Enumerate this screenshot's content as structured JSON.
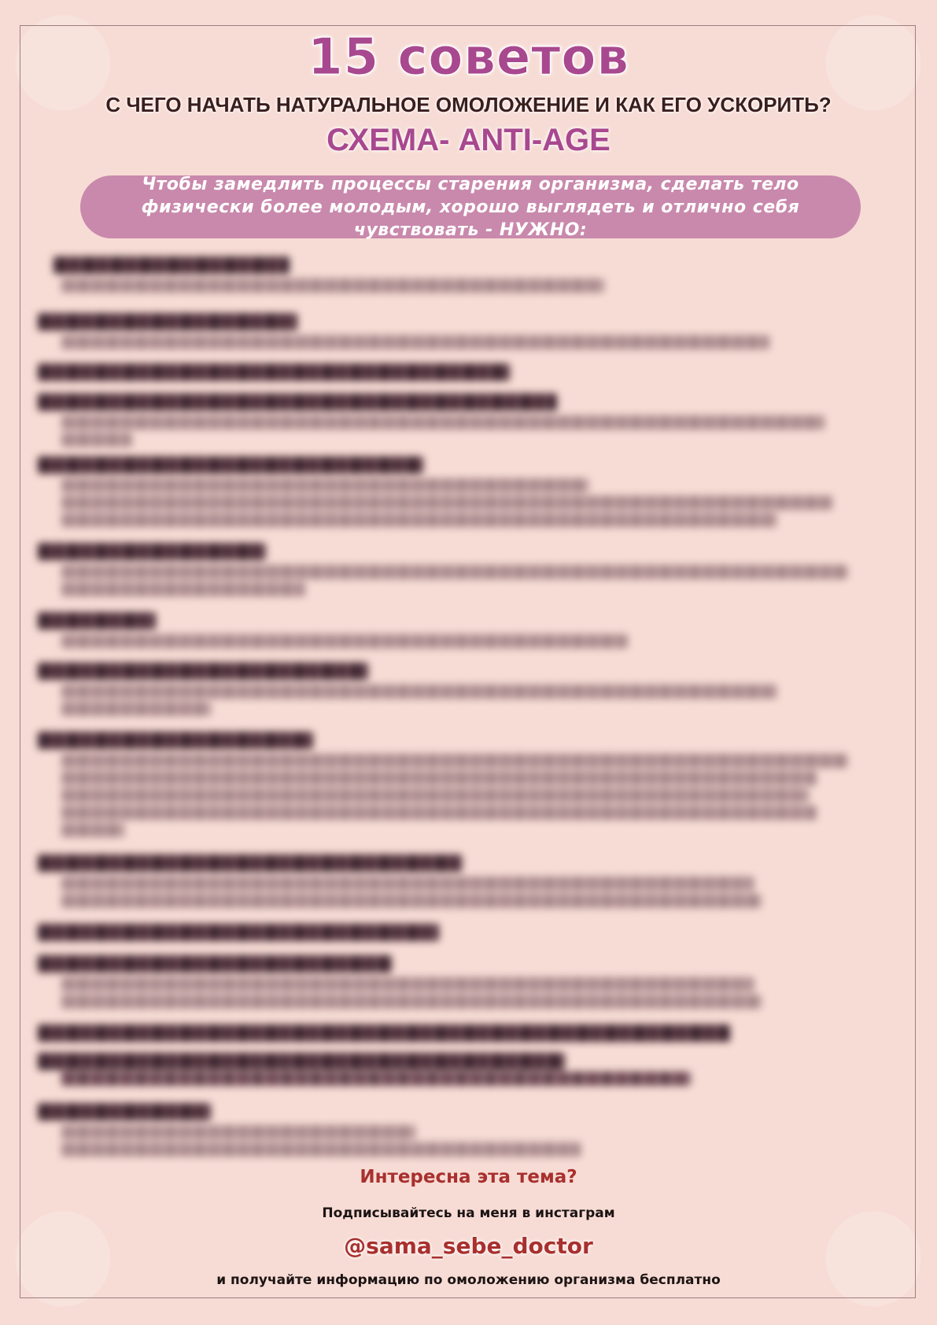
{
  "header": {
    "title": "15 советов",
    "subtitle": "С ЧЕГО НАЧАТЬ НАТУРАЛЬНОЕ ОМОЛОЖЕНИЕ И КАК ЕГО УСКОРИТЬ?",
    "scheme": "СХЕМА- ANTI-AGE"
  },
  "intro": {
    "text": "Чтобы замедлить процессы старения организма, сделать тело физически более молодым, хорошо выглядеть и отлично себя чувствовать - НУЖНО:"
  },
  "footer": {
    "question": "Интересна эта тема?",
    "subscribe": "Подписывайтесь на меня в инстаграм",
    "handle": "@sama_sebe_doctor",
    "closing": "и получайте информацию по омоложению организма бесплатно"
  },
  "colors": {
    "background": "#f7dcd5",
    "accent": "#a8488f",
    "intro_band": "#c989ac",
    "footer_red": "#a8302e"
  }
}
